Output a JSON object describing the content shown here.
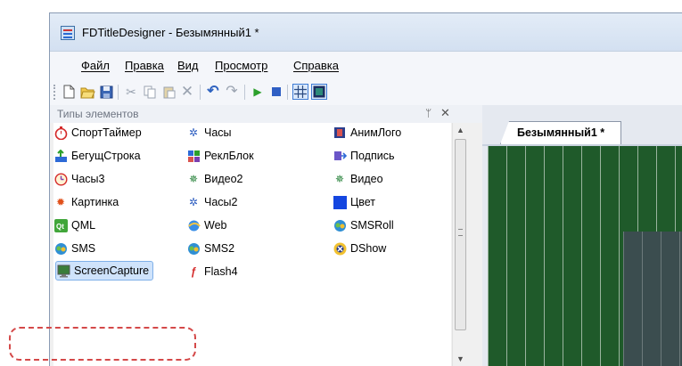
{
  "window": {
    "title": "FDTitleDesigner - Безымянный1 *"
  },
  "menu": [
    "Файл",
    "Правка",
    "Вид",
    "Просмотр",
    "Справка"
  ],
  "toolbar": {
    "icons": [
      "new-icon",
      "open-icon",
      "save-icon",
      "cut-icon",
      "copy-icon",
      "paste-icon",
      "delete-icon",
      "undo-icon",
      "redo-icon",
      "play-icon",
      "stop-icon",
      "grid-icon",
      "frame-icon"
    ]
  },
  "panel": {
    "title": "Типы элементов",
    "pin_glyph": "ᛘ",
    "close_glyph": "✕",
    "items": [
      {
        "label": "СпортТаймер",
        "icon": "stopwatch-icon"
      },
      {
        "label": "Часы",
        "icon": "clock-sparkle-icon"
      },
      {
        "label": "АнимЛого",
        "icon": "film-icon"
      },
      {
        "label": "БегущСтрока",
        "icon": "ticker-icon"
      },
      {
        "label": "РеклБлок",
        "icon": "ad-block-icon"
      },
      {
        "label": "Подпись",
        "icon": "caption-icon"
      },
      {
        "label": "Часы3",
        "icon": "clock3-icon"
      },
      {
        "label": "Видео2",
        "icon": "video2-icon"
      },
      {
        "label": "Видео",
        "icon": "video-icon"
      },
      {
        "label": "Картинка",
        "icon": "picture-icon"
      },
      {
        "label": "Часы2",
        "icon": "clock2-icon"
      },
      {
        "label": "Цвет",
        "icon": "color-icon"
      },
      {
        "label": "QML",
        "icon": "qt-icon"
      },
      {
        "label": "Web",
        "icon": "web-icon"
      },
      {
        "label": "SMSRoll",
        "icon": "sms-roll-icon"
      },
      {
        "label": "SMS",
        "icon": "sms-icon"
      },
      {
        "label": "SMS2",
        "icon": "sms2-icon"
      },
      {
        "label": "DShow",
        "icon": "dshow-icon"
      },
      {
        "label": "ScreenCapture",
        "icon": "screen-capture-icon",
        "selected": true
      },
      {
        "label": "Flash4",
        "icon": "flash-icon"
      }
    ]
  },
  "editor": {
    "tab_label": "Безымянный1 *"
  },
  "colors": {
    "canvas": "#1f5a2a",
    "selection": "#cfe3fb",
    "highlight": "#d44949"
  }
}
